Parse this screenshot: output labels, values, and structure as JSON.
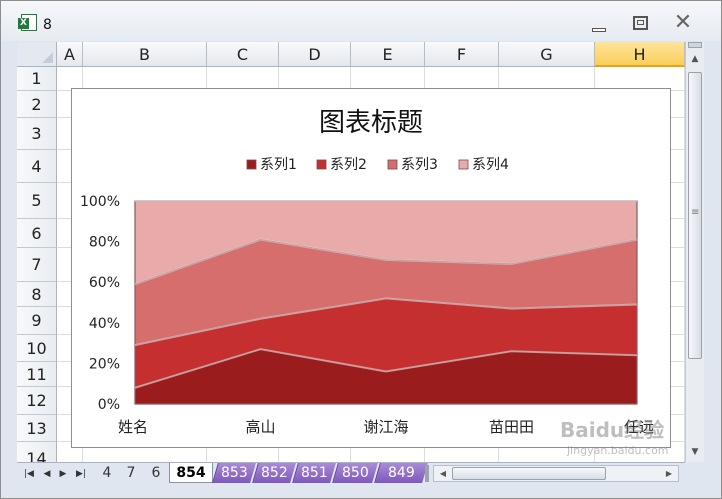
{
  "window": {
    "title": "8"
  },
  "spreadsheet": {
    "columns": [
      "A",
      "B",
      "C",
      "D",
      "E",
      "F",
      "G",
      "H"
    ],
    "selected_column": "H",
    "rows": [
      "1",
      "2",
      "3",
      "4",
      "5",
      "6",
      "7",
      "8",
      "9",
      "10",
      "11",
      "12",
      "13",
      "14"
    ]
  },
  "sheet_tabs": {
    "items": [
      "4",
      "7",
      "6",
      "854",
      "853",
      "852",
      "851",
      "850",
      "849"
    ],
    "active": "854"
  },
  "chart_data": {
    "type": "area",
    "stacked": "percent",
    "title": "图表标题",
    "categories": [
      "姓名",
      "高山",
      "谢江海",
      "苗田田",
      "任远"
    ],
    "series": [
      {
        "name": "系列1",
        "values": [
          8,
          27,
          16,
          26,
          24
        ],
        "color": "#9b1c1c"
      },
      {
        "name": "系列2",
        "values": [
          21,
          15,
          36,
          21,
          25
        ],
        "color": "#c62f2f"
      },
      {
        "name": "系列3",
        "values": [
          30,
          39,
          19,
          22,
          32
        ],
        "color": "#d76e6e"
      },
      {
        "name": "系列4",
        "values": [
          41,
          19,
          29,
          31,
          19
        ],
        "color": "#e9aaaa"
      }
    ],
    "y_ticks": [
      "0%",
      "20%",
      "40%",
      "60%",
      "80%",
      "100%"
    ],
    "ylim": [
      0,
      100
    ],
    "legend_position": "top",
    "grid": false
  },
  "watermark": {
    "logo": "Baidu经验",
    "url": "jingyan.baidu.com"
  }
}
